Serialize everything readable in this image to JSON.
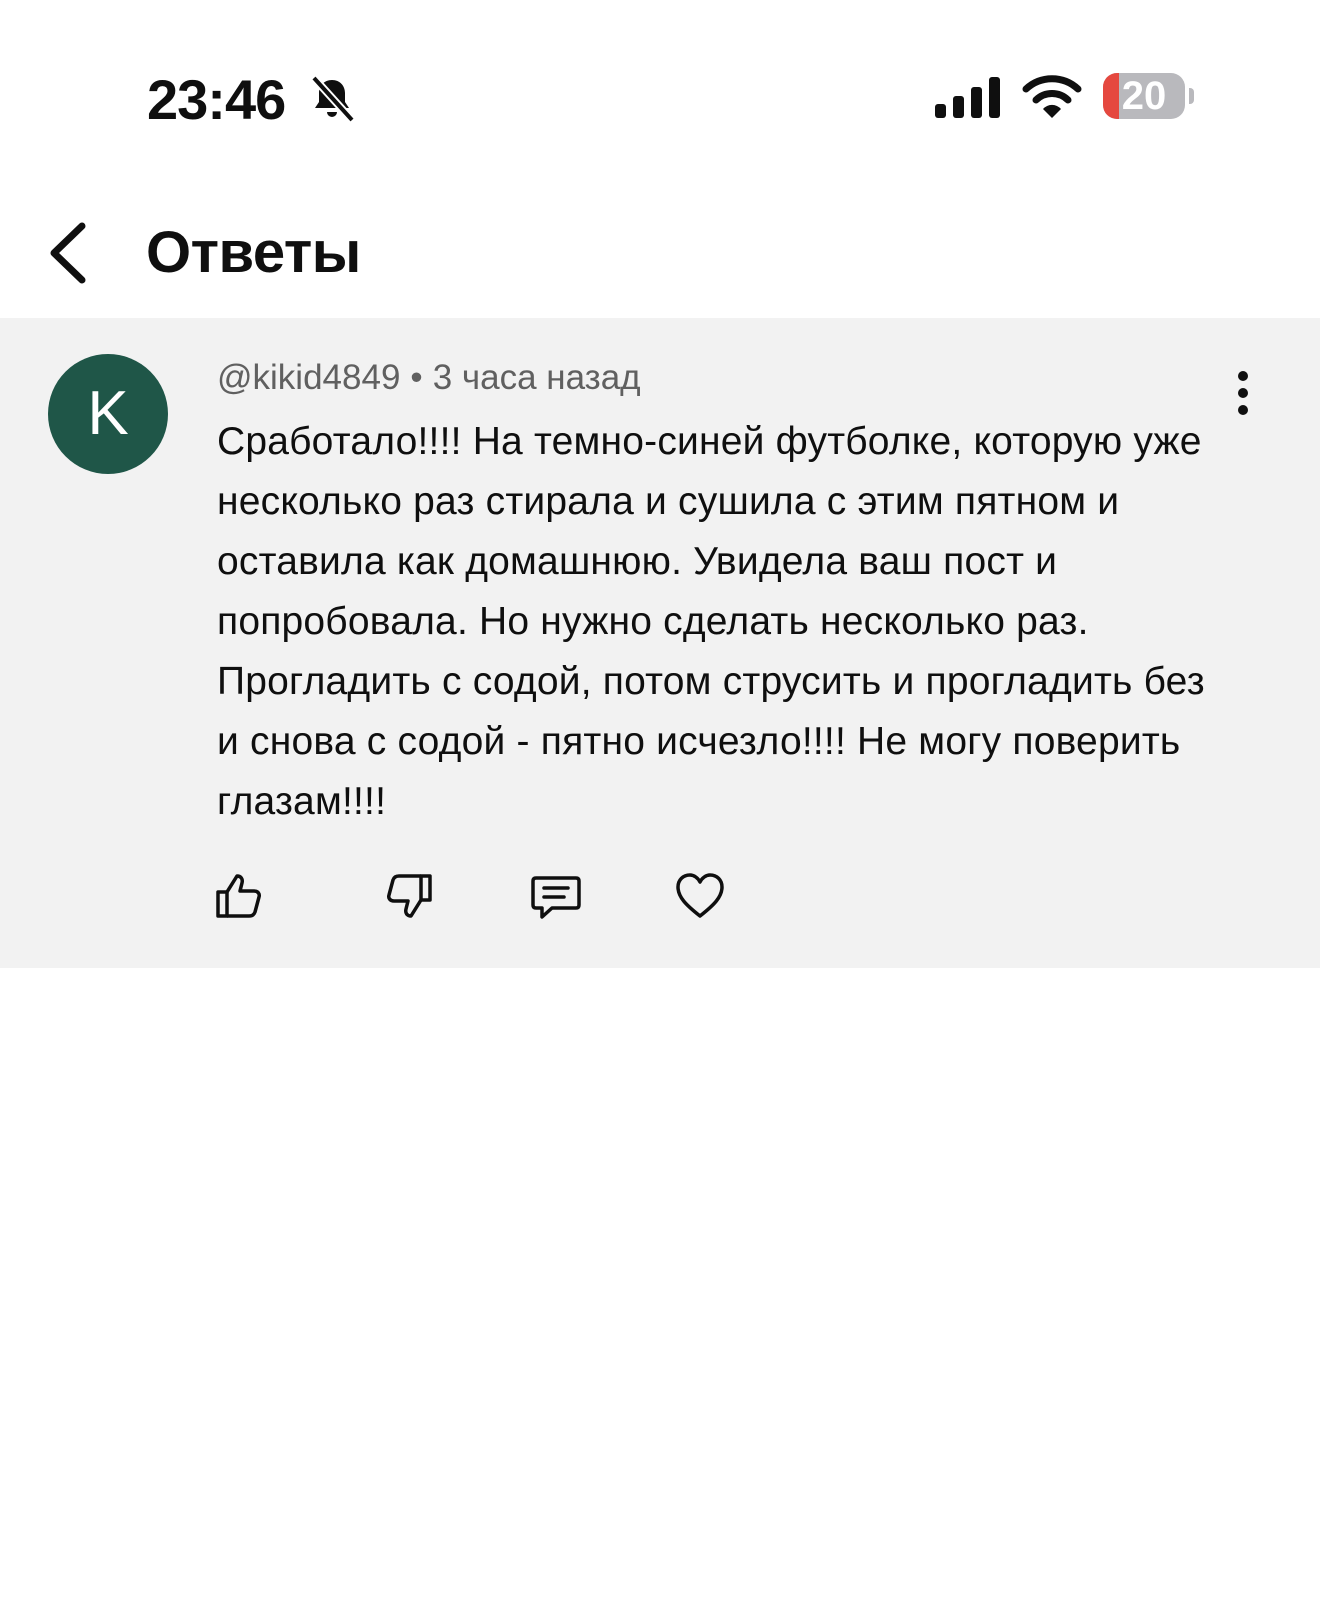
{
  "status_bar": {
    "time": "23:46",
    "battery_level": "20",
    "battery_low_color": "#e5483f",
    "icons": [
      "bell-muted-icon",
      "signal-icon",
      "wifi-icon",
      "battery-icon"
    ]
  },
  "header": {
    "title": "Ответы",
    "back_icon": "chevron-left-icon"
  },
  "comment": {
    "avatar_letter": "K",
    "avatar_color": "#1f5648",
    "author": "@kikid4849",
    "separator": "•",
    "time_ago": "3 часа назад",
    "text": "Сработало!!!! На темно-синей футболке, которую уже несколько раз стирала и сушила с этим пятном и оставила как домашнюю. Увидела ваш пост и попробовала. Но нужно сделать несколько раз. Прогладить с содой, потом струсить и прогладить без и снова с содой - пятно исчезло!!!! Не могу поверить глазам!!!!",
    "actions": [
      "thumb-up-icon",
      "thumb-down-icon",
      "reply-icon",
      "heart-icon"
    ],
    "card_background": "#f2f2f2"
  }
}
